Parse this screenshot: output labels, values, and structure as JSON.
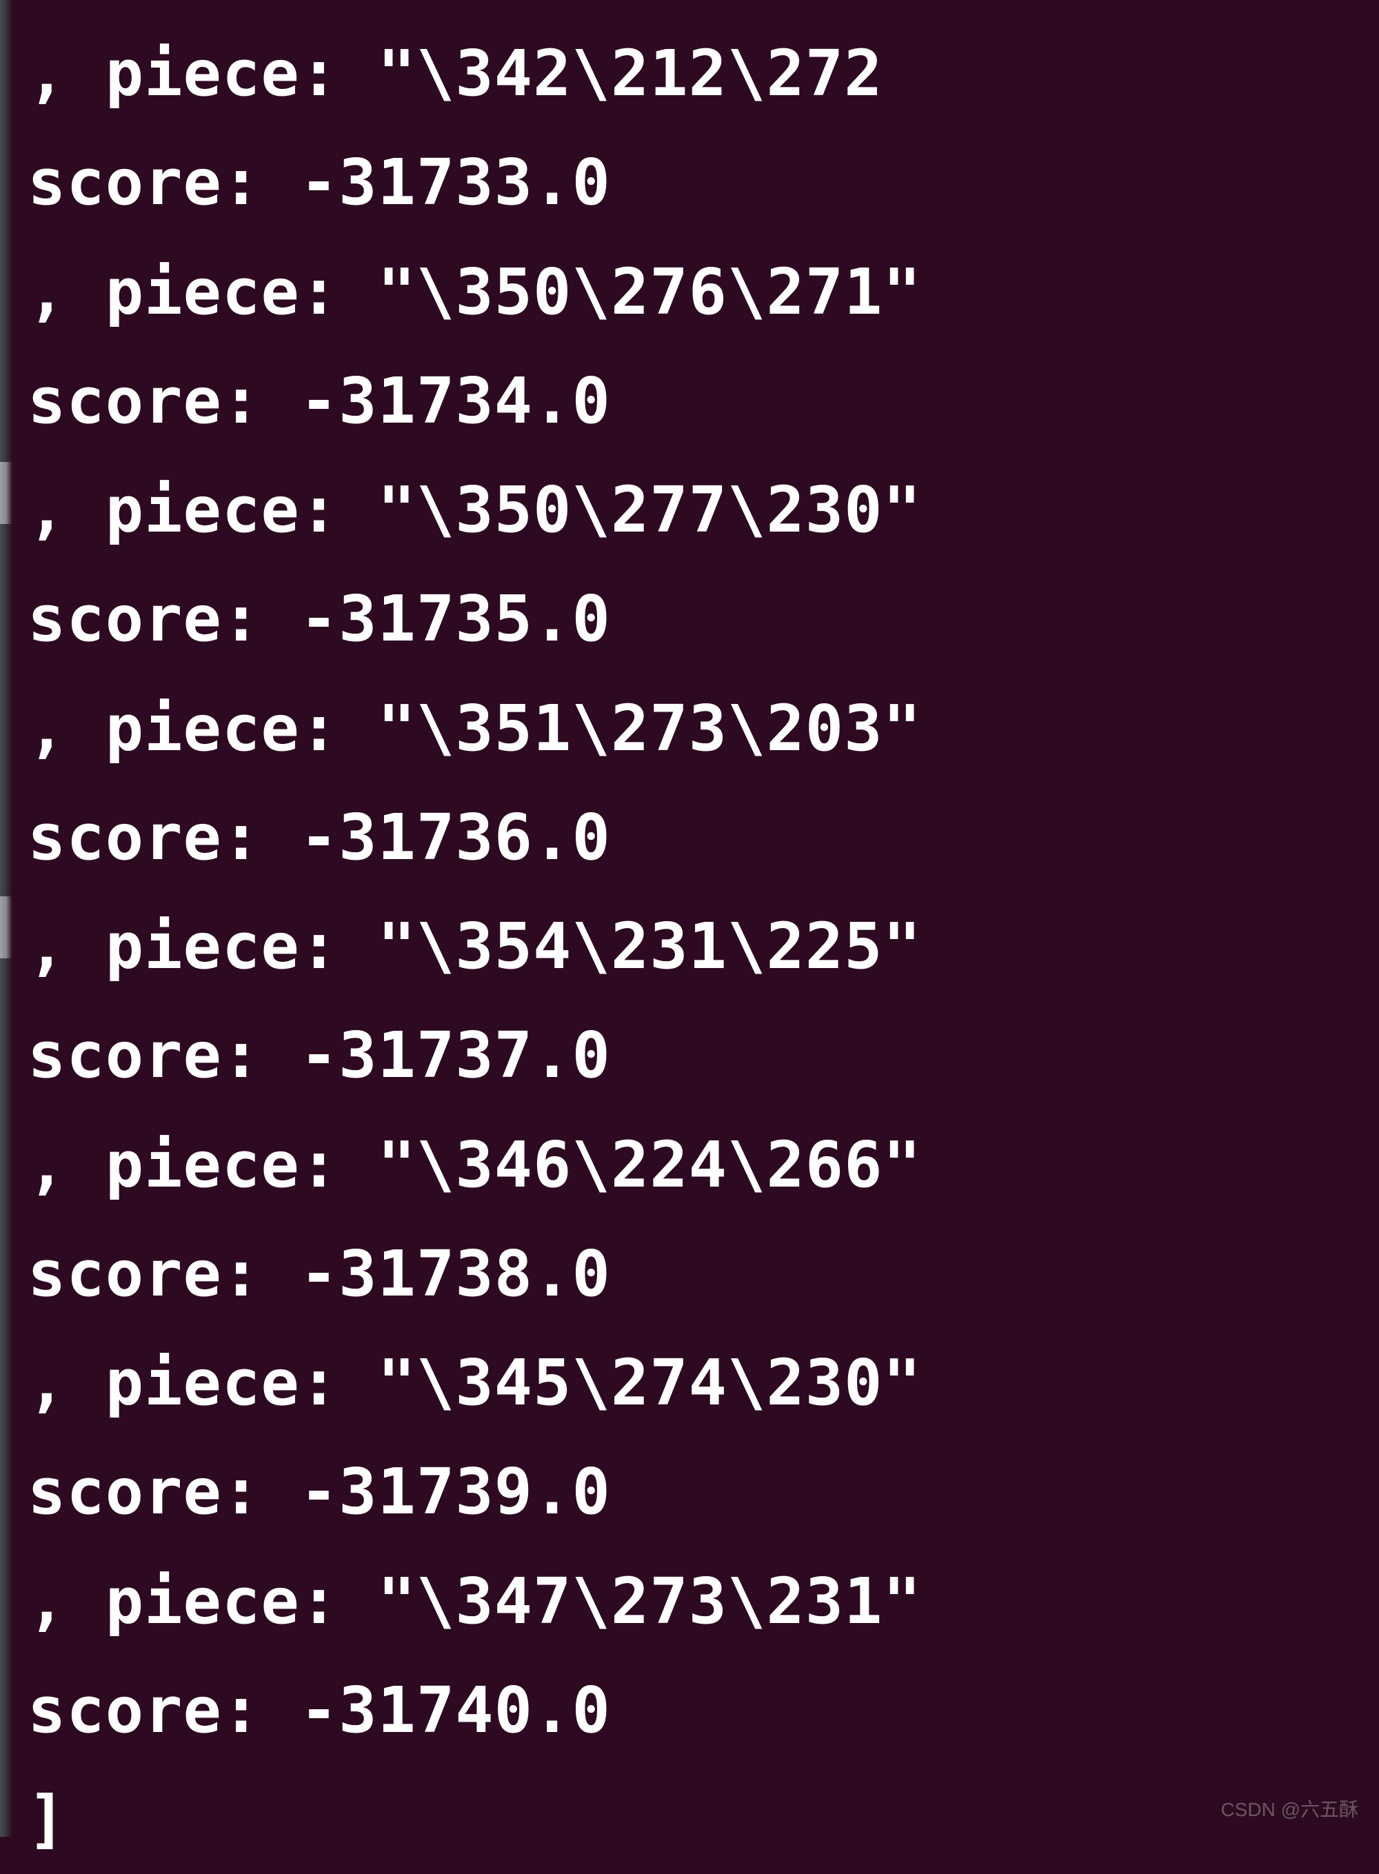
{
  "terminal": {
    "lines": [
      {
        "text": ", piece: \"\\342\\212\\272"
      },
      {
        "text": "score: -31733.0"
      },
      {
        "text": ", piece: \"\\350\\276\\271\""
      },
      {
        "text": "score: -31734.0"
      },
      {
        "text": ", piece: \"\\350\\277\\230\""
      },
      {
        "text": "score: -31735.0"
      },
      {
        "text": ", piece: \"\\351\\273\\203\""
      },
      {
        "text": "score: -31736.0"
      },
      {
        "text": ", piece: \"\\354\\231\\225\""
      },
      {
        "text": "score: -31737.0"
      },
      {
        "text": ", piece: \"\\346\\224\\266\""
      },
      {
        "text": "score: -31738.0"
      },
      {
        "text": ", piece: \"\\345\\274\\230\""
      },
      {
        "text": "score: -31739.0"
      },
      {
        "text": ", piece: \"\\347\\273\\231\""
      },
      {
        "text": "score: -31740.0"
      },
      {
        "text": "]"
      }
    ]
  },
  "watermark": {
    "text": "CSDN @六五酥"
  }
}
